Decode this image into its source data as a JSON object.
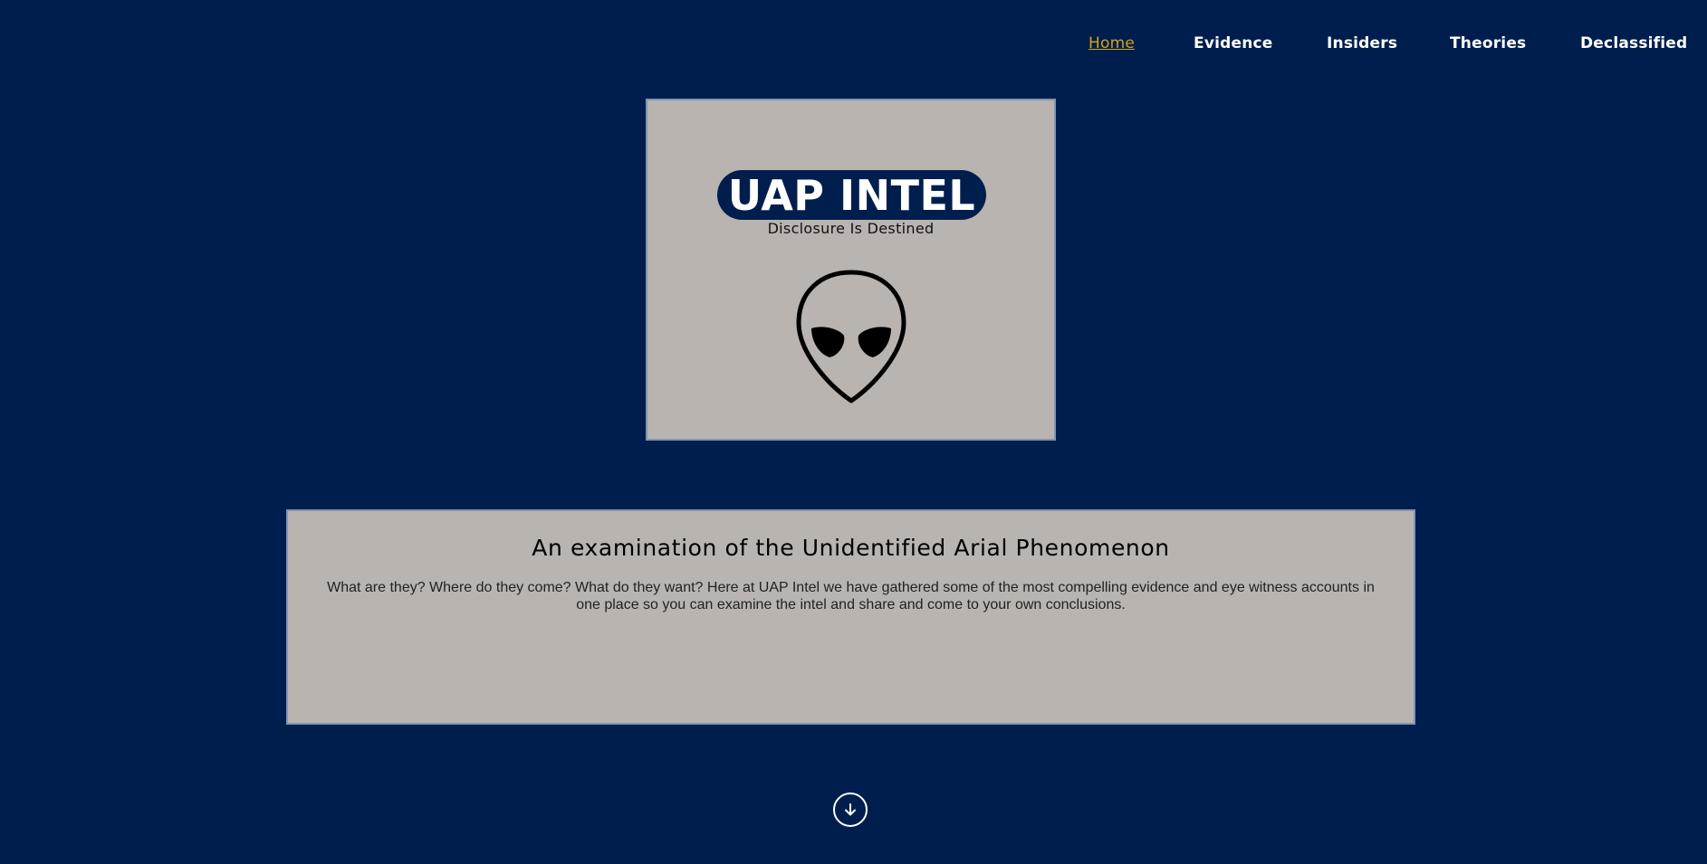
{
  "nav": {
    "items": [
      {
        "label": "Home",
        "active": true
      },
      {
        "label": "Evidence",
        "active": false
      },
      {
        "label": "Insiders",
        "active": false
      },
      {
        "label": "Theories",
        "active": false
      },
      {
        "label": "Declassified",
        "active": false
      }
    ]
  },
  "logo": {
    "title": "UAP INTEL",
    "tagline": "Disclosure Is Destined",
    "icon": "alien-head-icon"
  },
  "intro": {
    "heading": "An examination of the Unidentified Arial Phenomenon",
    "body": "What are they? Where do they come? What do they want? Here at UAP Intel we have gathered some of the most compelling evidence and eye witness accounts in one place so you can examine the intel and share and come to your own conclusions."
  },
  "scroll": {
    "icon": "arrow-down-icon"
  },
  "colors": {
    "background": "#001e4d",
    "card": "#b9b4af",
    "card_border": "#8195b3",
    "nav_active": "#d4a017",
    "nav_text": "#ffffff"
  }
}
